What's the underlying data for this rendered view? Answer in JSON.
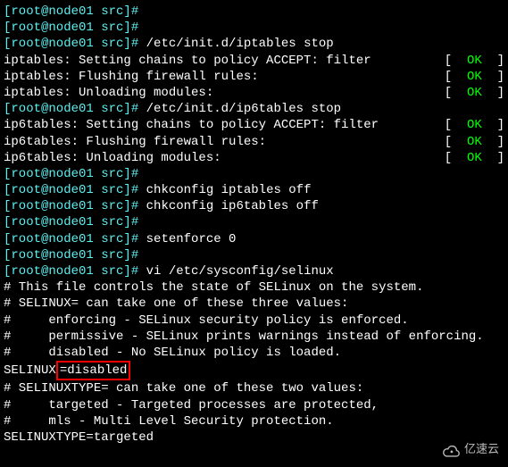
{
  "lines": {
    "l0": "[root@node01 src]#",
    "l1": "[root@node01 src]#",
    "l2_prompt": "[root@node01 src]# ",
    "l2_cmd": "/etc/init.d/iptables stop",
    "l3_left": "iptables: Setting chains to policy ACCEPT: filter",
    "l3_ok": "OK",
    "l4_left": "iptables: Flushing firewall rules:",
    "l4_ok": "OK",
    "l5_left": "iptables: Unloading modules:",
    "l5_ok": "OK",
    "l6_prompt": "[root@node01 src]# ",
    "l6_cmd": "/etc/init.d/ip6tables stop",
    "l7_left": "ip6tables: Setting chains to policy ACCEPT: filter",
    "l7_ok": "OK",
    "l8_left": "ip6tables: Flushing firewall rules:",
    "l8_ok": "OK",
    "l9_left": "ip6tables: Unloading modules:",
    "l9_ok": "OK",
    "l10": "[root@node01 src]#",
    "l11_prompt": "[root@node01 src]# ",
    "l11_cmd": "chkconfig iptables off",
    "l12_prompt": "[root@node01 src]# ",
    "l12_cmd": "chkconfig ip6tables off",
    "l13": "[root@node01 src]#",
    "l14_prompt": "[root@node01 src]# ",
    "l14_cmd": "setenforce 0",
    "l15": "[root@node01 src]#",
    "l16_prompt": "[root@node01 src]# ",
    "l16_cmd": "vi /etc/sysconfig/selinux",
    "blank": "",
    "c1": "# This file controls the state of SELinux on the system.",
    "c2": "# SELINUX= can take one of these three values:",
    "c3": "#     enforcing - SELinux security policy is enforced.",
    "c4": "#     permissive - SELinux prints warnings instead of enforcing.",
    "c5": "#     disabled - No SELinux policy is loaded.",
    "c6_left": "SELINUX",
    "c6_box": "=disabled",
    "c7": "# SELINUXTYPE= can take one of these two values:",
    "c8": "#     targeted - Targeted processes are protected,",
    "c9": "#     mls - Multi Level Security protection.",
    "c10": "SELINUXTYPE=targeted"
  },
  "status": {
    "lbracket": "[  ",
    "rbracket": "  ]"
  },
  "watermark": "亿速云"
}
